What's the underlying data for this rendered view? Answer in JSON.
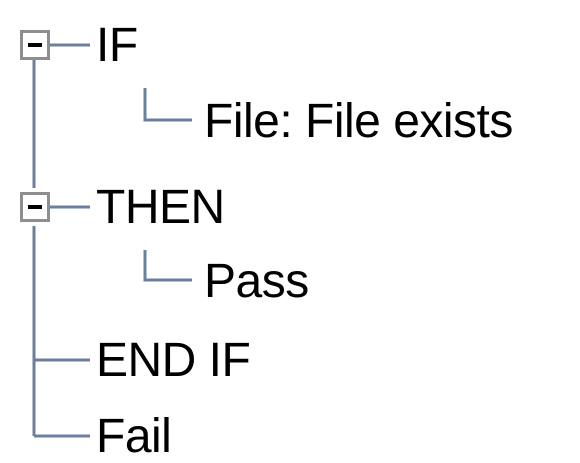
{
  "tree": {
    "nodes": [
      {
        "label": "IF",
        "expander": "collapse-minus-icon",
        "expanded": true,
        "children": [
          {
            "label": "File: File exists"
          }
        ]
      },
      {
        "label": "THEN",
        "expander": "collapse-minus-icon",
        "expanded": true,
        "children": [
          {
            "label": "Pass"
          }
        ]
      },
      {
        "label": "END IF"
      },
      {
        "label": "Fail"
      }
    ]
  },
  "colors": {
    "connector_line": "#6b7f9e",
    "expander_border": "#8e8e8e",
    "text": "#000000",
    "background": "#ffffff"
  }
}
